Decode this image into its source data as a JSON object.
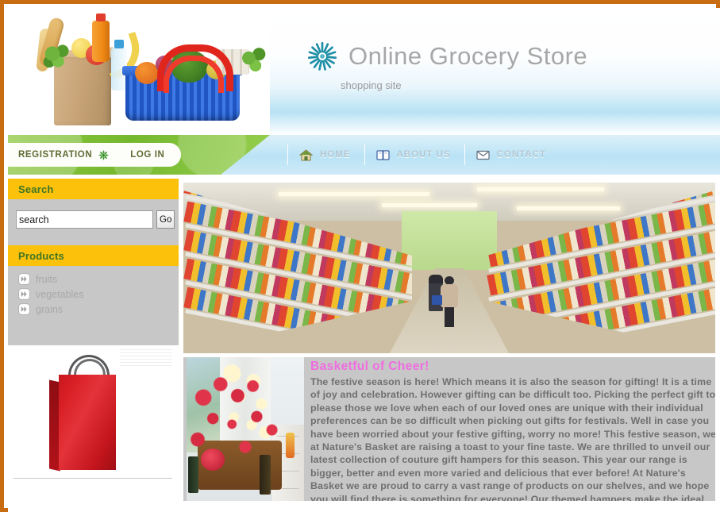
{
  "site": {
    "brand": "Online Grocery Store",
    "tagline": "shopping site",
    "logo_icon": "radial-burst-icon",
    "accent_orange": "#c96b10",
    "accent_yellow": "#fcc10b",
    "accent_green": "#3f7524",
    "nav_blue": "#b9e3f5",
    "title_pink": "#f06ce0"
  },
  "account_nav": {
    "registration_label": "REGISTRATION",
    "registration_icon": "leaf-icon",
    "login_label": "LOG IN"
  },
  "main_nav": {
    "items": [
      {
        "label": "HOME",
        "icon": "home-icon"
      },
      {
        "label": "ABOUT US",
        "icon": "book-icon"
      },
      {
        "label": "CONTACT",
        "icon": "envelope-icon"
      }
    ]
  },
  "sidebar": {
    "search": {
      "heading": "Search",
      "value": "search",
      "placeholder": "search",
      "button_label": "Go"
    },
    "products": {
      "heading": "Products",
      "items": [
        {
          "label": "fruits",
          "icon": "fast-forward-icon"
        },
        {
          "label": "vegetables",
          "icon": "fast-forward-icon"
        },
        {
          "label": "grains",
          "icon": "fast-forward-icon"
        }
      ]
    },
    "promo_image_alt": "red-shopping-bag"
  },
  "main": {
    "banner_alt": "supermarket-aisle-photo",
    "article": {
      "image_alt": "festive-gift-hamper-photo",
      "title": "Basketful of Cheer!",
      "body": "The festive season is here! Which means it is also the season for gifting! It is a time of joy and celebration. However gifting can be difficult too. Picking the perfect gift to please those we love when each of our loved ones are unique with their individual preferences can be so difficult when picking out gifts for festivals. Well in case you have been worried about your festive gifting, worry no more! This festive season, we at Nature's Basket are raising a toast to your fine taste. We are thrilled to unveil our latest collection of couture gift hampers for this season. This year our range is bigger, better and even more varied and delicious that ever before! At Nature's Basket we are proud to carry a vast range of products on our shelves, and we hope you will find there is something for everyone! Our themed hampers make the ideal gift to show you care."
    }
  }
}
